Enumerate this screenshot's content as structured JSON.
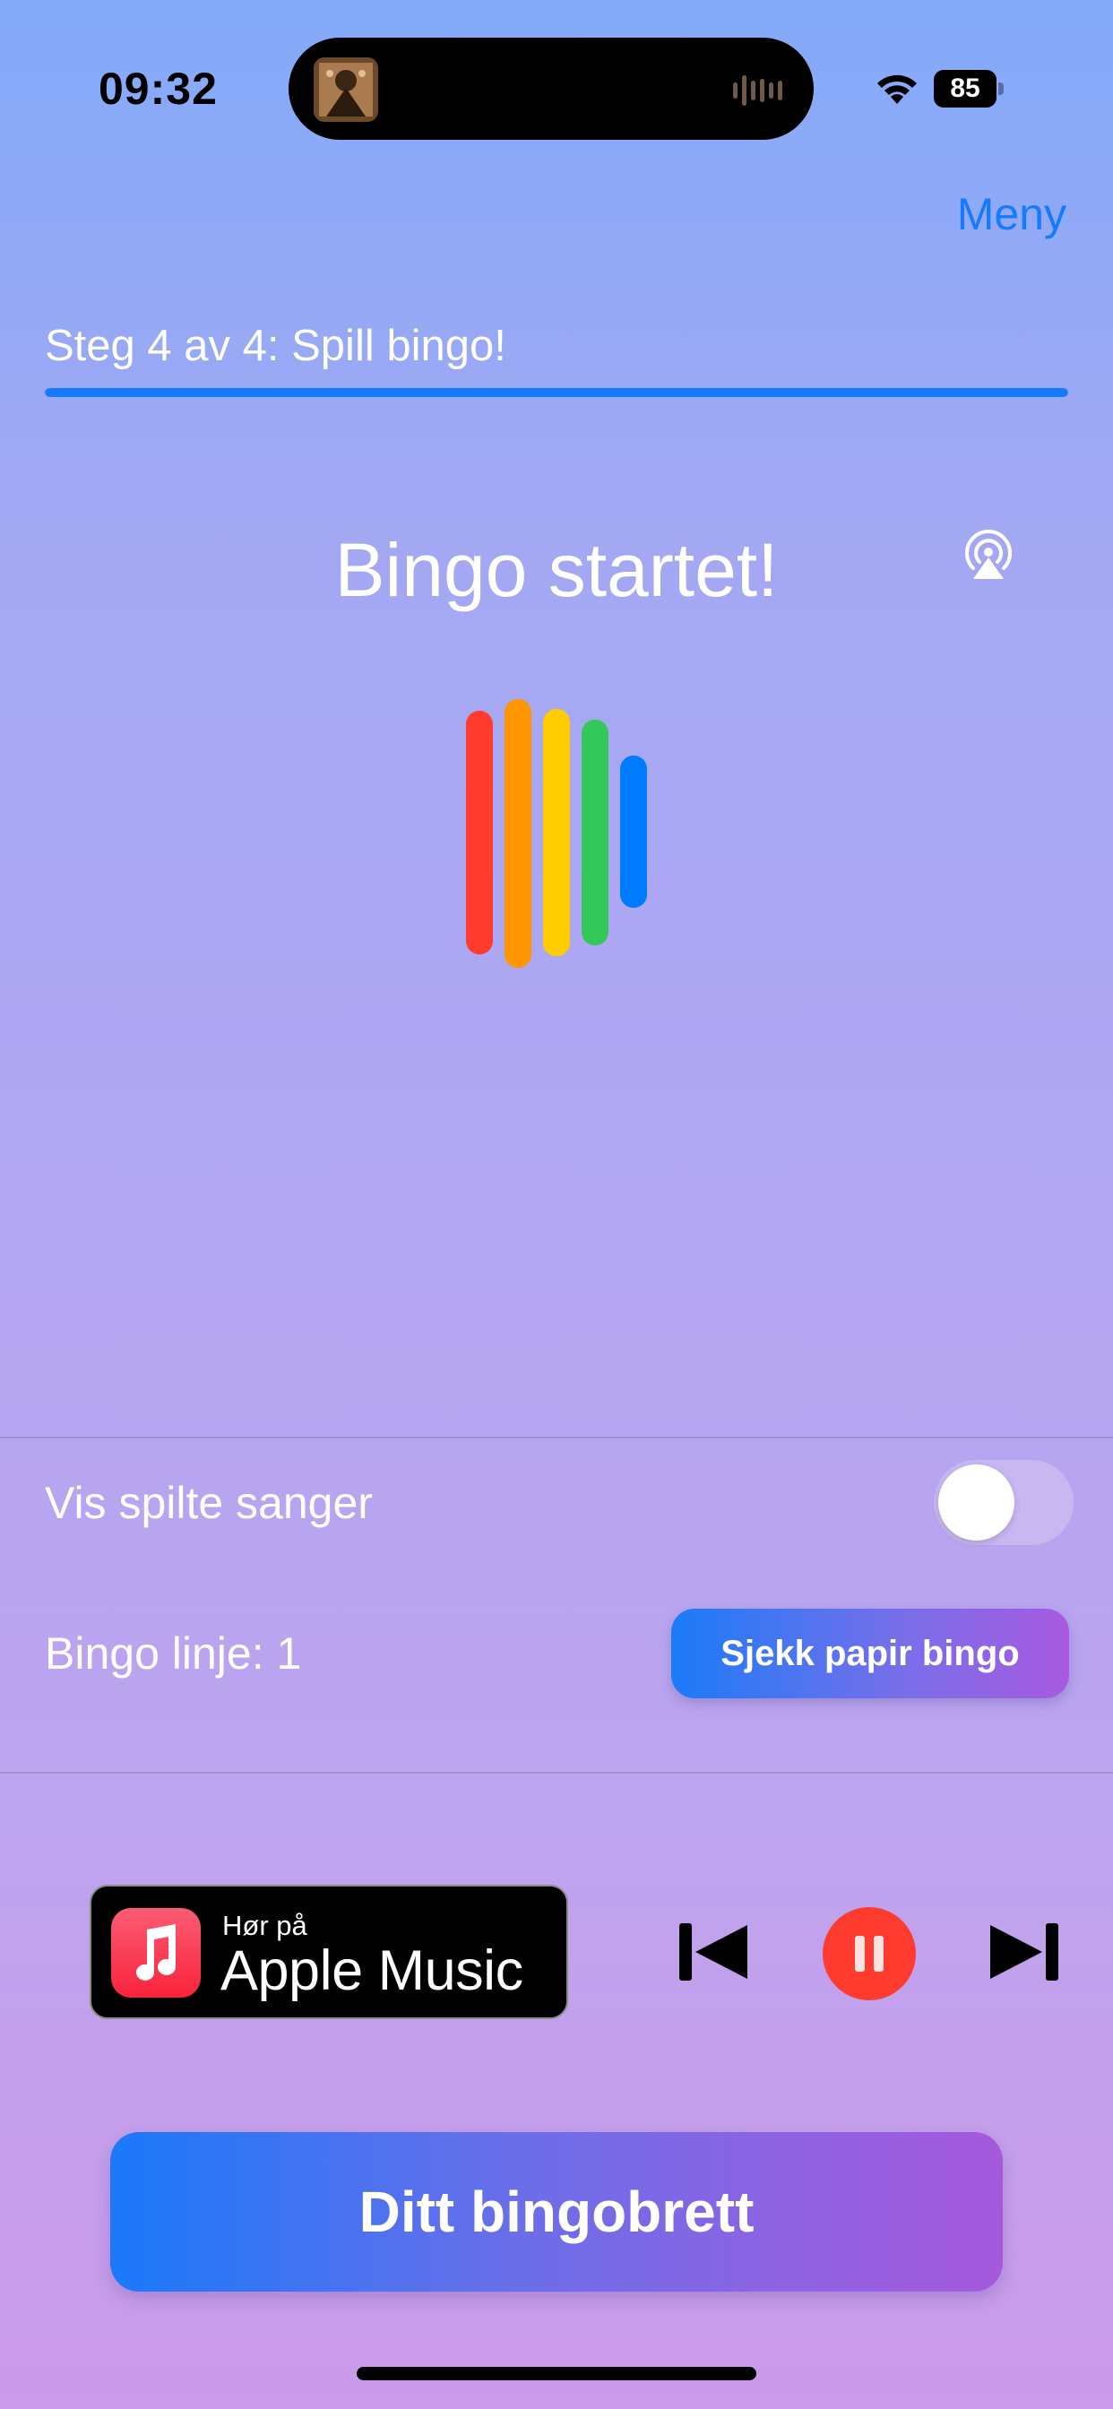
{
  "status_bar": {
    "time": "09:32",
    "battery_level": "85",
    "icons": [
      "now-playing-artwork",
      "audio-waveform-icon",
      "wifi-icon",
      "battery-icon"
    ]
  },
  "header": {
    "menu_label": "Meny",
    "step_label": "Steg 4 av 4: Spill bingo!",
    "progress_fraction": 1.0
  },
  "main": {
    "title": "Bingo startet!",
    "airplay_icon": "airplay-icon",
    "visualizer_colors": [
      "#ff3b30",
      "#ff9500",
      "#ffcc00",
      "#34c759",
      "#007aff"
    ]
  },
  "settings": {
    "show_played_label": "Vis spilte sanger",
    "show_played_on": false,
    "bingo_line_label": "Bingo linje: 1",
    "check_paper_label": "Sjekk papir bingo"
  },
  "player": {
    "apple_music_small": "Hør på",
    "apple_music_big": "Apple Music",
    "controls": [
      "previous-track-icon",
      "pause-icon",
      "next-track-icon"
    ],
    "accent": "#ff3b30"
  },
  "bottom": {
    "board_button_label": "Ditt bingobrett"
  },
  "colors": {
    "link_blue": "#147bff",
    "gradient_start": "#1a79fa",
    "gradient_end": "#a659dc"
  }
}
